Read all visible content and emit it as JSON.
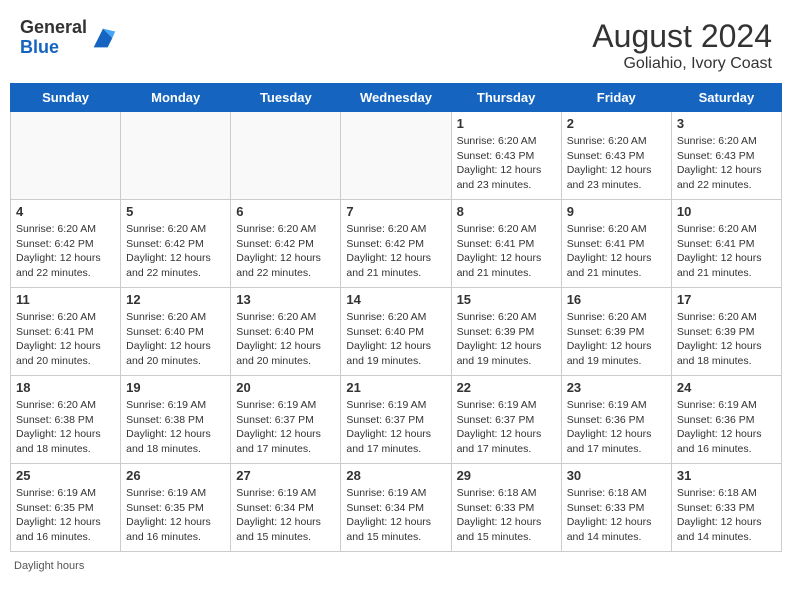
{
  "header": {
    "logo_general": "General",
    "logo_blue": "Blue",
    "month_year": "August 2024",
    "location": "Goliahio, Ivory Coast"
  },
  "days_of_week": [
    "Sunday",
    "Monday",
    "Tuesday",
    "Wednesday",
    "Thursday",
    "Friday",
    "Saturday"
  ],
  "weeks": [
    [
      {
        "day": "",
        "info": ""
      },
      {
        "day": "",
        "info": ""
      },
      {
        "day": "",
        "info": ""
      },
      {
        "day": "",
        "info": ""
      },
      {
        "day": "1",
        "info": "Sunrise: 6:20 AM\nSunset: 6:43 PM\nDaylight: 12 hours\nand 23 minutes."
      },
      {
        "day": "2",
        "info": "Sunrise: 6:20 AM\nSunset: 6:43 PM\nDaylight: 12 hours\nand 23 minutes."
      },
      {
        "day": "3",
        "info": "Sunrise: 6:20 AM\nSunset: 6:43 PM\nDaylight: 12 hours\nand 22 minutes."
      }
    ],
    [
      {
        "day": "4",
        "info": "Sunrise: 6:20 AM\nSunset: 6:42 PM\nDaylight: 12 hours\nand 22 minutes."
      },
      {
        "day": "5",
        "info": "Sunrise: 6:20 AM\nSunset: 6:42 PM\nDaylight: 12 hours\nand 22 minutes."
      },
      {
        "day": "6",
        "info": "Sunrise: 6:20 AM\nSunset: 6:42 PM\nDaylight: 12 hours\nand 22 minutes."
      },
      {
        "day": "7",
        "info": "Sunrise: 6:20 AM\nSunset: 6:42 PM\nDaylight: 12 hours\nand 21 minutes."
      },
      {
        "day": "8",
        "info": "Sunrise: 6:20 AM\nSunset: 6:41 PM\nDaylight: 12 hours\nand 21 minutes."
      },
      {
        "day": "9",
        "info": "Sunrise: 6:20 AM\nSunset: 6:41 PM\nDaylight: 12 hours\nand 21 minutes."
      },
      {
        "day": "10",
        "info": "Sunrise: 6:20 AM\nSunset: 6:41 PM\nDaylight: 12 hours\nand 21 minutes."
      }
    ],
    [
      {
        "day": "11",
        "info": "Sunrise: 6:20 AM\nSunset: 6:41 PM\nDaylight: 12 hours\nand 20 minutes."
      },
      {
        "day": "12",
        "info": "Sunrise: 6:20 AM\nSunset: 6:40 PM\nDaylight: 12 hours\nand 20 minutes."
      },
      {
        "day": "13",
        "info": "Sunrise: 6:20 AM\nSunset: 6:40 PM\nDaylight: 12 hours\nand 20 minutes."
      },
      {
        "day": "14",
        "info": "Sunrise: 6:20 AM\nSunset: 6:40 PM\nDaylight: 12 hours\nand 19 minutes."
      },
      {
        "day": "15",
        "info": "Sunrise: 6:20 AM\nSunset: 6:39 PM\nDaylight: 12 hours\nand 19 minutes."
      },
      {
        "day": "16",
        "info": "Sunrise: 6:20 AM\nSunset: 6:39 PM\nDaylight: 12 hours\nand 19 minutes."
      },
      {
        "day": "17",
        "info": "Sunrise: 6:20 AM\nSunset: 6:39 PM\nDaylight: 12 hours\nand 18 minutes."
      }
    ],
    [
      {
        "day": "18",
        "info": "Sunrise: 6:20 AM\nSunset: 6:38 PM\nDaylight: 12 hours\nand 18 minutes."
      },
      {
        "day": "19",
        "info": "Sunrise: 6:19 AM\nSunset: 6:38 PM\nDaylight: 12 hours\nand 18 minutes."
      },
      {
        "day": "20",
        "info": "Sunrise: 6:19 AM\nSunset: 6:37 PM\nDaylight: 12 hours\nand 17 minutes."
      },
      {
        "day": "21",
        "info": "Sunrise: 6:19 AM\nSunset: 6:37 PM\nDaylight: 12 hours\nand 17 minutes."
      },
      {
        "day": "22",
        "info": "Sunrise: 6:19 AM\nSunset: 6:37 PM\nDaylight: 12 hours\nand 17 minutes."
      },
      {
        "day": "23",
        "info": "Sunrise: 6:19 AM\nSunset: 6:36 PM\nDaylight: 12 hours\nand 17 minutes."
      },
      {
        "day": "24",
        "info": "Sunrise: 6:19 AM\nSunset: 6:36 PM\nDaylight: 12 hours\nand 16 minutes."
      }
    ],
    [
      {
        "day": "25",
        "info": "Sunrise: 6:19 AM\nSunset: 6:35 PM\nDaylight: 12 hours\nand 16 minutes."
      },
      {
        "day": "26",
        "info": "Sunrise: 6:19 AM\nSunset: 6:35 PM\nDaylight: 12 hours\nand 16 minutes."
      },
      {
        "day": "27",
        "info": "Sunrise: 6:19 AM\nSunset: 6:34 PM\nDaylight: 12 hours\nand 15 minutes."
      },
      {
        "day": "28",
        "info": "Sunrise: 6:19 AM\nSunset: 6:34 PM\nDaylight: 12 hours\nand 15 minutes."
      },
      {
        "day": "29",
        "info": "Sunrise: 6:18 AM\nSunset: 6:33 PM\nDaylight: 12 hours\nand 15 minutes."
      },
      {
        "day": "30",
        "info": "Sunrise: 6:18 AM\nSunset: 6:33 PM\nDaylight: 12 hours\nand 14 minutes."
      },
      {
        "day": "31",
        "info": "Sunrise: 6:18 AM\nSunset: 6:33 PM\nDaylight: 12 hours\nand 14 minutes."
      }
    ]
  ],
  "footer": {
    "daylight_label": "Daylight hours"
  }
}
